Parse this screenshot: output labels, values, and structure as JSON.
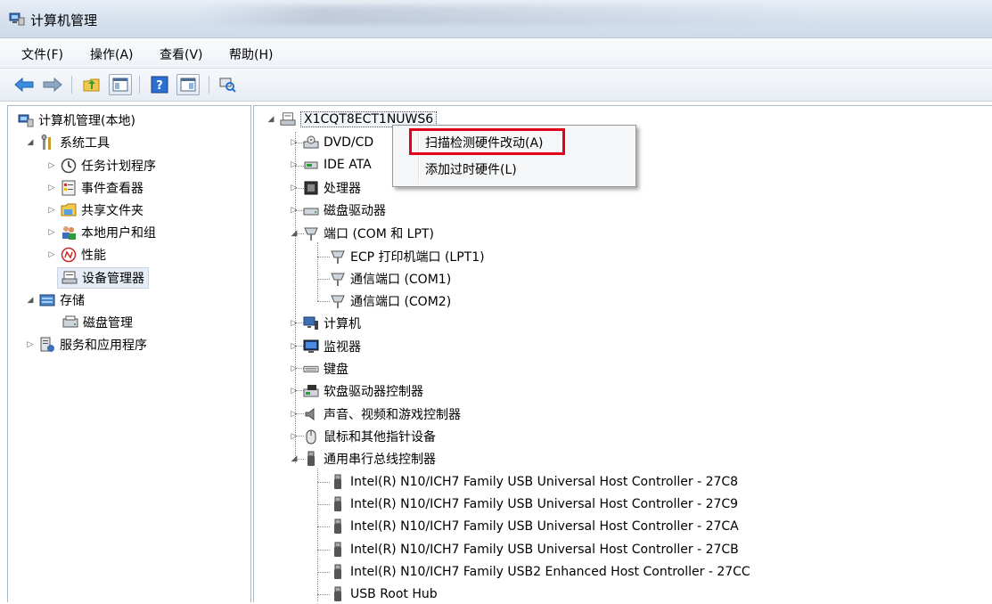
{
  "window": {
    "title": "计算机管理"
  },
  "menu": [
    "文件(F)",
    "操作(A)",
    "查看(V)",
    "帮助(H)"
  ],
  "left_tree": {
    "root": "计算机管理(本地)",
    "system_tools": "系统工具",
    "task_scheduler": "任务计划程序",
    "event_viewer": "事件查看器",
    "shared_folders": "共享文件夹",
    "local_users": "本地用户和组",
    "performance": "性能",
    "device_manager": "设备管理器",
    "storage": "存储",
    "disk_management": "磁盘管理",
    "services_apps": "服务和应用程序"
  },
  "device_tree": {
    "computer_name": "X1CQT8ECT1NUWS6",
    "dvd": "DVD/CD",
    "ide": "IDE ATA",
    "processors": "处理器",
    "disk_drives": "磁盘驱动器",
    "ports": "端口 (COM 和 LPT)",
    "ports_children": [
      "ECP 打印机端口 (LPT1)",
      "通信端口 (COM1)",
      "通信端口 (COM2)"
    ],
    "computer": "计算机",
    "monitors": "监视器",
    "keyboard": "键盘",
    "floppy": "软盘驱动器控制器",
    "sound": "声音、视频和游戏控制器",
    "mice": "鼠标和其他指针设备",
    "usb": "通用串行总线控制器",
    "usb_children": [
      "Intel(R) N10/ICH7 Family USB Universal Host Controller - 27C8",
      "Intel(R) N10/ICH7 Family USB Universal Host Controller - 27C9",
      "Intel(R) N10/ICH7 Family USB Universal Host Controller - 27CA",
      "Intel(R) N10/ICH7 Family USB Universal Host Controller - 27CB",
      "Intel(R) N10/ICH7 Family USB2 Enhanced Host Controller - 27CC",
      "USB Root Hub"
    ]
  },
  "context_menu": {
    "scan": "扫描检测硬件改动(A)",
    "add_legacy": "添加过时硬件(L)"
  },
  "colors": {
    "highlight_border": "#e0001a"
  }
}
